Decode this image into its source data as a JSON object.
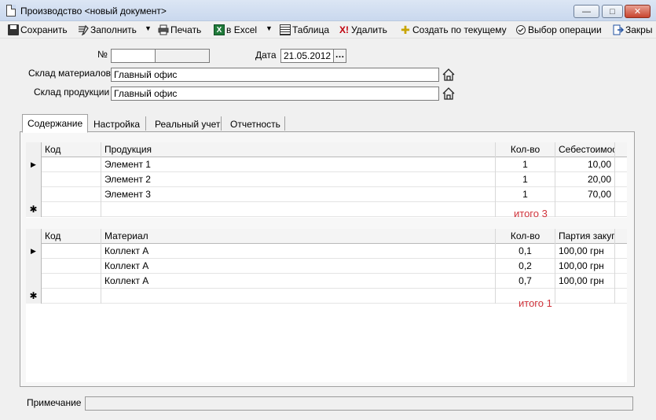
{
  "window": {
    "title": "Производство <новый документ>",
    "minimize_glyph": "—",
    "maximize_glyph": "□",
    "close_glyph": "✕"
  },
  "toolbar": {
    "save": "Сохранить",
    "fill": "Заполнить",
    "print": "Печать",
    "excel": "в Excel",
    "table": "Таблица",
    "delete": "Удалить",
    "create_from_current": "Создать по текущему",
    "choose_operation": "Выбор операции",
    "close": "Закры",
    "dropdown_glyph": "▼",
    "excel_icon_glyph": "X",
    "delete_icon_glyph": "X!",
    "create_icon_glyph": "✚"
  },
  "header": {
    "number_label": "№",
    "number_value": "",
    "date_label": "Дата",
    "date_value": "21.05.2012",
    "date_button": "…",
    "materials_warehouse_label": "Склад материалов",
    "materials_warehouse_value": "Главный офис",
    "products_warehouse_label": "Склад продукции",
    "products_warehouse_value": "Главный офис"
  },
  "tabs": [
    {
      "label": "Содержание",
      "active": true
    },
    {
      "label": "Настройка",
      "active": false
    },
    {
      "label": "Реальный учет",
      "active": false
    },
    {
      "label": "Отчетность",
      "active": false
    }
  ],
  "products_grid": {
    "columns": [
      "Код",
      "Продукция",
      "Кол-во",
      "Себестоимос"
    ],
    "rows": [
      {
        "marker": "▶",
        "code": "",
        "name": "Элемент 1",
        "qty": "1",
        "cost": "10,00"
      },
      {
        "marker": "",
        "code": "",
        "name": "Элемент 2",
        "qty": "1",
        "cost": "20,00"
      },
      {
        "marker": "",
        "code": "",
        "name": "Элемент 3",
        "qty": "1",
        "cost": "70,00"
      }
    ],
    "new_row_marker": "✱",
    "total": "итого 3"
  },
  "materials_grid": {
    "columns": [
      "Код",
      "Материал",
      "Кол-во",
      "Партия закуп"
    ],
    "rows": [
      {
        "marker": "▶",
        "code": "",
        "name": "Коллект А",
        "qty": "0,1",
        "batch": "100,00 грн"
      },
      {
        "marker": "",
        "code": "",
        "name": "Коллект А",
        "qty": "0,2",
        "batch": "100,00 грн"
      },
      {
        "marker": "",
        "code": "",
        "name": "Коллект А",
        "qty": "0,7",
        "batch": "100,00 грн"
      }
    ],
    "new_row_marker": "✱",
    "total": "итого 1"
  },
  "footer": {
    "note_label": "Примечание",
    "note_value": ""
  }
}
